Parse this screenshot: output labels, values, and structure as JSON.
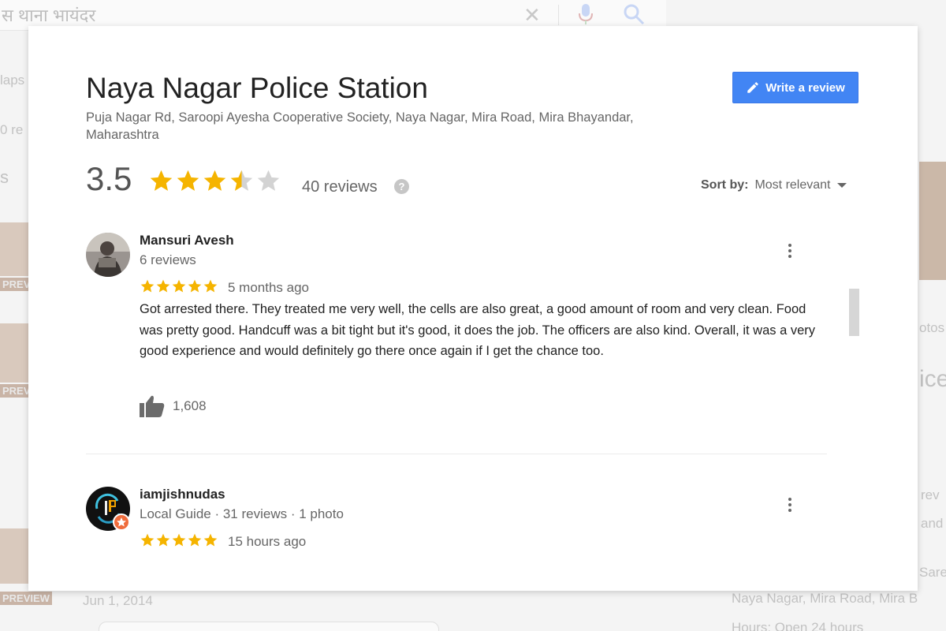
{
  "background": {
    "search_text": "स थाना भायंदर",
    "left_snippets": [
      "laps",
      "0 re",
      "s"
    ],
    "preview_label": "PREVIEW",
    "right_snippets": [
      "otos",
      "ice",
      "rev",
      "and",
      "Sare",
      "Naya Nagar, Mira Road, Mira B",
      "Hours: Open 24 hours"
    ],
    "date": "Jun 1, 2014"
  },
  "place": {
    "name": "Naya Nagar Police Station",
    "address": "Puja Nagar Rd, Saroopi Ayesha Cooperative Society, Naya Nagar, Mira Road, Mira Bhayandar, Maharashtra",
    "rating": "3.5",
    "rating_value": 3.5,
    "reviews_label": "40 reviews",
    "help_icon": "?"
  },
  "toolbar": {
    "write_review_label": "Write a review",
    "sort_label": "Sort by:",
    "sort_value": "Most relevant"
  },
  "reviews": [
    {
      "name": "Mansuri Avesh",
      "meta": "6 reviews",
      "rating": 5,
      "time": "5 months ago",
      "text": "Got arrested there. They treated me very well, the cells are also great, a good amount of room and very clean.  Food was pretty good. Handcuff was a bit tight but it's good, it does the job. The officers are also kind. Overall, it was a very good experience and would definitely go there once again if I get the chance too.",
      "likes": "1,608"
    },
    {
      "name": "iamjishnudas",
      "meta": "Local Guide · 31 reviews · 1 photo",
      "rating": 5,
      "time": "15 hours ago"
    }
  ],
  "colors": {
    "star": "#f5b400",
    "star_empty": "#d3d3d3",
    "accent": "#4285f4",
    "local_guide_badge": "#ef6c3c"
  },
  "icons": [
    "pencil-icon",
    "star-icon",
    "help-icon",
    "caret-down-icon",
    "more-vert-icon",
    "thumbs-up-icon",
    "close-icon",
    "mic-icon",
    "search-icon",
    "local-guide-badge-icon"
  ]
}
